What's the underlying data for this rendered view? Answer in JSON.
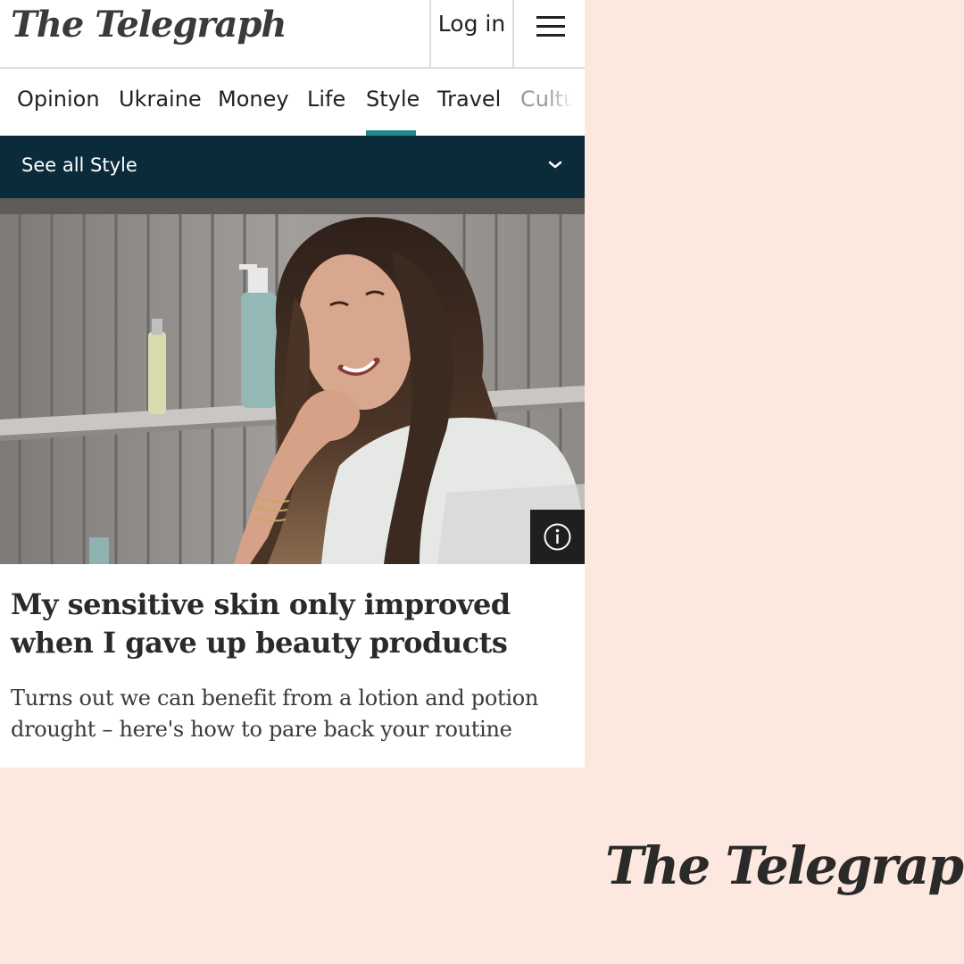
{
  "header": {
    "logo_text": "The Telegraph",
    "login_label": "Log in",
    "menu_icon": "hamburger-menu-icon"
  },
  "nav": {
    "items": [
      "Opinion",
      "Ukraine",
      "Money",
      "Life",
      "Style",
      "Travel",
      "Cultu"
    ],
    "active_index": 4,
    "active_color": "#1a8a8a"
  },
  "section_bar": {
    "label": "See all Style",
    "icon": "chevron-down-icon",
    "background": "#0b2a3a"
  },
  "article": {
    "image_info_icon": "info-icon",
    "headline": "My sensitive skin only improved when I gave up beauty products",
    "standfirst": "Turns out we can benefit from a lotion and potion drought – here's how to pare back your routine"
  },
  "brand": {
    "logo_text": "The Telegraph",
    "page_background": "#fde8df"
  }
}
